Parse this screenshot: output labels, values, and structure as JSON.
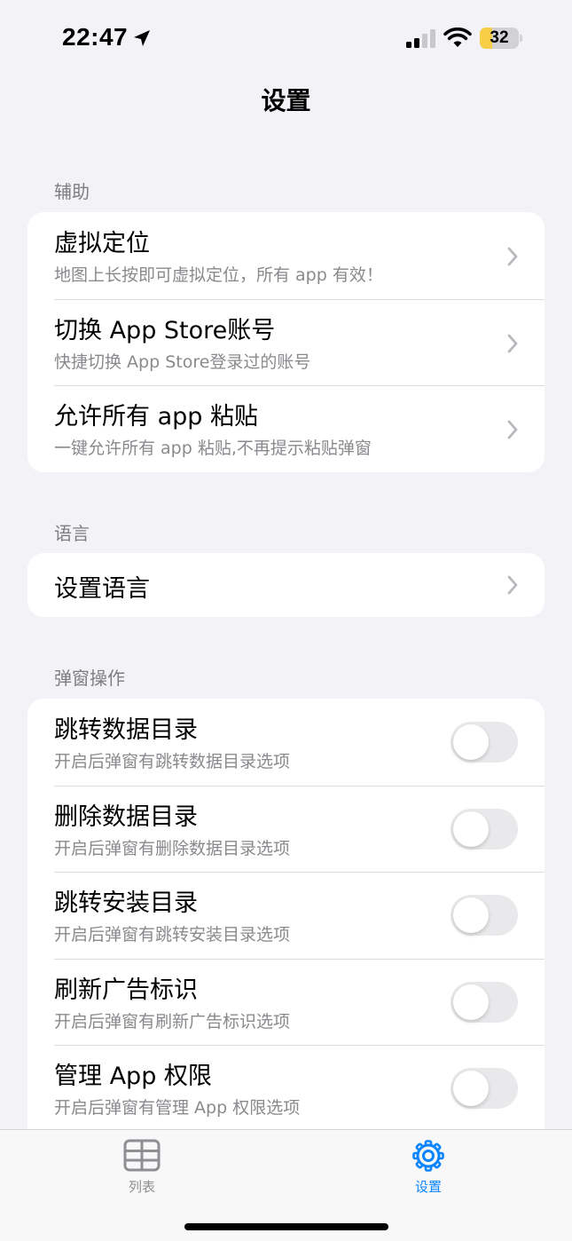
{
  "status_bar": {
    "time": "22:47",
    "battery_level": "32",
    "battery_color": "#f7ce46"
  },
  "nav": {
    "title": "设置"
  },
  "sections": [
    {
      "header": "辅助",
      "rows": [
        {
          "title": "虚拟定位",
          "subtitle": "地图上长按即可虚拟定位，所有 app 有效！",
          "accessory": "chevron-right-icon"
        },
        {
          "title": "切换 App Store账号",
          "subtitle": "快捷切换 App Store登录过的账号",
          "accessory": "chevron-right-icon"
        },
        {
          "title": "允许所有 app 粘贴",
          "subtitle": "一键允许所有 app 粘贴,不再提示粘贴弹窗",
          "accessory": "chevron-right-icon"
        }
      ]
    },
    {
      "header": "语言",
      "rows": [
        {
          "title": "设置语言",
          "accessory": "chevron-right-icon"
        }
      ]
    },
    {
      "header": "弹窗操作",
      "rows": [
        {
          "title": "跳转数据目录",
          "subtitle": "开启后弹窗有跳转数据目录选项",
          "toggle": false
        },
        {
          "title": "删除数据目录",
          "subtitle": "开启后弹窗有删除数据目录选项",
          "toggle": false
        },
        {
          "title": "跳转安装目录",
          "subtitle": "开启后弹窗有跳转安装目录选项",
          "toggle": false
        },
        {
          "title": "刷新广告标识",
          "subtitle": "开启后弹窗有刷新广告标识选项",
          "toggle": false
        },
        {
          "title": "管理 App 权限",
          "subtitle": "开启后弹窗有管理 App 权限选项",
          "toggle": false
        }
      ]
    }
  ],
  "tab_bar": {
    "tabs": [
      {
        "label": "列表",
        "icon": "table-icon",
        "selected": false
      },
      {
        "label": "设置",
        "icon": "gear-icon",
        "selected": true
      }
    ],
    "active_color": "#0a84ff",
    "inactive_color": "#8e8e93"
  }
}
